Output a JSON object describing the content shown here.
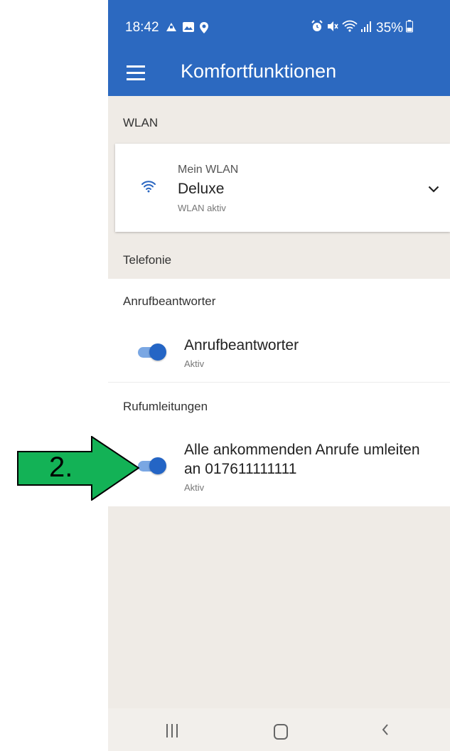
{
  "status_bar": {
    "time": "18:42",
    "battery": "35%",
    "left_icons": [
      "notification-icon",
      "image-icon",
      "location-icon"
    ],
    "right_icons": [
      "alarm-icon",
      "mute-icon",
      "wifi-icon",
      "signal-icon",
      "battery-icon"
    ]
  },
  "toolbar": {
    "title": "Komfortfunktionen"
  },
  "wlan_section": {
    "header": "WLAN",
    "card": {
      "caption": "Mein WLAN",
      "name": "Deluxe",
      "status": "WLAN aktiv"
    }
  },
  "telefonie_section": {
    "header": "Telefonie",
    "anrufbeantworter": {
      "group_label": "Anrufbeantworter",
      "title": "Anrufbeantworter",
      "status": "Aktiv",
      "enabled": true
    },
    "rufumleitungen": {
      "group_label": "Rufumleitungen",
      "title_line1": "Alle ankommenden Anrufe umleiten",
      "title_line2": "an 017611111111",
      "status": "Aktiv",
      "enabled": true
    }
  },
  "annotation": {
    "label": "2."
  },
  "colors": {
    "primary": "#2c69c0",
    "background": "#efebe6",
    "toggle_on": "#2465c5",
    "arrow_fill": "#13b256"
  }
}
